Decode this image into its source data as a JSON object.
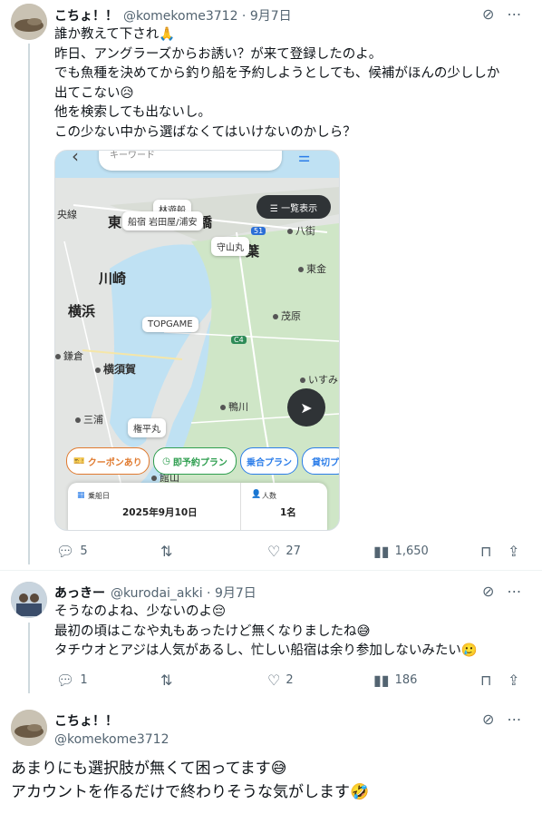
{
  "tweet1": {
    "display_name": "こちょ！！",
    "handle": "@komekome3712 · 9月7日",
    "lines": [
      "誰か教えて下され🙏",
      "昨日、アングラーズからお誘い？が来て登録したのよ。",
      "でも魚種を決めてから釣り船を予約しようとしても、候補がほんの少ししか",
      "出てこない😥",
      "他を検索しても出ないし。",
      "この少ない中から選ばなくてはいけないのかしら？"
    ],
    "map": {
      "search_placeholder": "キーワード",
      "list_button": "☰ 一覧表示",
      "labels": [
        "林遊船",
        "船宿 岩田屋/浦安",
        "守山丸",
        "TOPGAME",
        "権平丸"
      ],
      "places": [
        "央線",
        "東",
        "橋",
        "葉",
        "八街",
        "川崎",
        "東金",
        "横浜",
        "茂原",
        "横須賀",
        "鎌倉",
        "三浦",
        "いすみ",
        "鴨川",
        "館山"
      ],
      "road_numbers": [
        "51",
        "C4"
      ],
      "filters": [
        "クーポンあり",
        "即予約プラン",
        "乗合プラン",
        "貸切プ"
      ],
      "date_label": "乗船日",
      "date_value": "2025年9月10日",
      "people_label": "人数",
      "people_value": "1名"
    },
    "actions": {
      "replies": "5",
      "retweets": "",
      "likes": "27",
      "views": "1,650"
    }
  },
  "tweet2": {
    "display_name": "あっきー",
    "handle": "@kurodai_akki · 9月7日",
    "lines": [
      "そうなのよね、少ないのよ😔",
      "最初の頃はこなや丸もあったけど無くなりましたね😅",
      "タチウオとアジは人気があるし、忙しい船宿は余り参加しないみたい🥲"
    ],
    "actions": {
      "replies": "1",
      "retweets": "",
      "likes": "2",
      "views": "186"
    }
  },
  "tweet3": {
    "display_name": "こちょ！！",
    "handle": "@komekome3712",
    "lines": [
      "あまりにも選択肢が無くて困ってます😅",
      "アカウントを作るだけで終わりそうな気がします🤣"
    ]
  },
  "colors": {
    "accent": "#1d9bf0",
    "muted": "#536471",
    "coupon": "#e07a2f",
    "green": "#2e9e4f",
    "blue": "#2b7de9"
  },
  "icons": [
    "grok-icon",
    "more-icon",
    "reply-icon",
    "retweet-icon",
    "like-icon",
    "views-icon",
    "bookmark-icon",
    "share-icon"
  ]
}
